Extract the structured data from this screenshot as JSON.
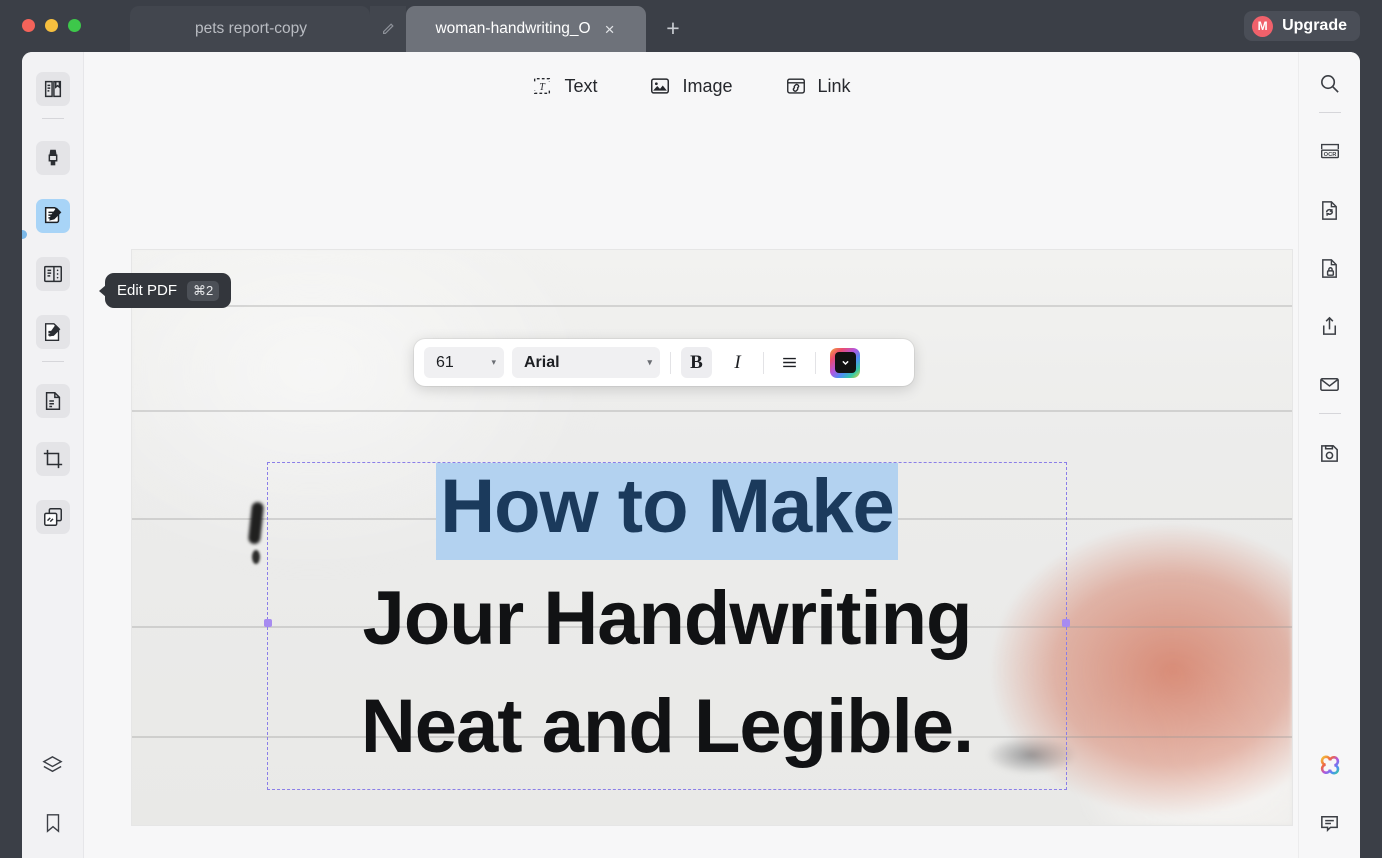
{
  "window": {
    "traffic_lights": [
      "close",
      "minimize",
      "zoom"
    ]
  },
  "tabs": [
    {
      "label": "pets report-copy",
      "active": false,
      "icon": "pencil-icon"
    },
    {
      "label": "woman-handwriting_O",
      "active": true,
      "close": "×"
    }
  ],
  "new_tab_label": "+",
  "upgrade": {
    "badge": "M",
    "label": "Upgrade",
    "badge_color": "#f0616b"
  },
  "toolbar_top": [
    {
      "label": "Text",
      "icon": "text-icon"
    },
    {
      "label": "Image",
      "icon": "image-icon"
    },
    {
      "label": "Link",
      "icon": "link-icon"
    }
  ],
  "font_toolbar": {
    "size_value": "61",
    "font_value": "Arial",
    "caret": "▾",
    "bold_label": "B",
    "italic_label": "I",
    "align_label": "≡",
    "color_caret": "▾",
    "color_swatch": "#111111"
  },
  "tooltip": {
    "text": "Edit PDF",
    "shortcut": "⌘2"
  },
  "sidebar_left": [
    {
      "name": "reader-view",
      "icon": "book-open-icon",
      "boxed": true,
      "selected": false
    },
    {
      "name": "separator-1",
      "icon": "divider",
      "boxed": false,
      "selected": false
    },
    {
      "name": "markup-highlighter",
      "icon": "highlighter-icon",
      "boxed": true,
      "selected": false
    },
    {
      "name": "edit-pdf",
      "icon": "edit-document-icon",
      "boxed": false,
      "selected": true
    },
    {
      "name": "organize-pages",
      "icon": "pages-list-icon",
      "boxed": true,
      "selected": false
    },
    {
      "name": "fill-and-sign",
      "icon": "sign-document-icon",
      "boxed": true,
      "selected": false
    },
    {
      "name": "separator-2",
      "icon": "divider",
      "boxed": false,
      "selected": false
    },
    {
      "name": "compress-file",
      "icon": "file-lines-icon",
      "boxed": true,
      "selected": false
    },
    {
      "name": "crop-page",
      "icon": "crop-icon",
      "boxed": true,
      "selected": false
    },
    {
      "name": "duplicate-pages",
      "icon": "copy-pages-icon",
      "boxed": true,
      "selected": false
    }
  ],
  "sidebar_left_bottom": [
    {
      "name": "layers",
      "icon": "layers-icon"
    },
    {
      "name": "bookmarks",
      "icon": "bookmark-icon"
    }
  ],
  "sidebar_right": [
    {
      "name": "search",
      "icon": "search-icon"
    },
    {
      "name": "separator-1",
      "icon": "divider"
    },
    {
      "name": "ocr",
      "icon": "ocr-icon"
    },
    {
      "name": "convert",
      "icon": "convert-document-icon"
    },
    {
      "name": "protect",
      "icon": "lock-document-icon"
    },
    {
      "name": "share",
      "icon": "share-upload-icon"
    },
    {
      "name": "email",
      "icon": "envelope-icon"
    },
    {
      "name": "separator-2",
      "icon": "divider"
    },
    {
      "name": "save",
      "icon": "floppy-save-icon"
    }
  ],
  "sidebar_right_bottom": [
    {
      "name": "ai-assistant",
      "icon": "ai-clover-icon"
    },
    {
      "name": "comments",
      "icon": "comment-bubble-icon"
    }
  ],
  "document": {
    "line1": "How to Make",
    "line2": "Jour Handwriting",
    "line3": "Neat and Legible.",
    "line1_selected": true,
    "selection_highlight_color": "#b3d2f0",
    "line1_text_color": "#1b3a5c",
    "body_text_color": "#111214",
    "selection_frame_color": "#8b7ee8"
  }
}
